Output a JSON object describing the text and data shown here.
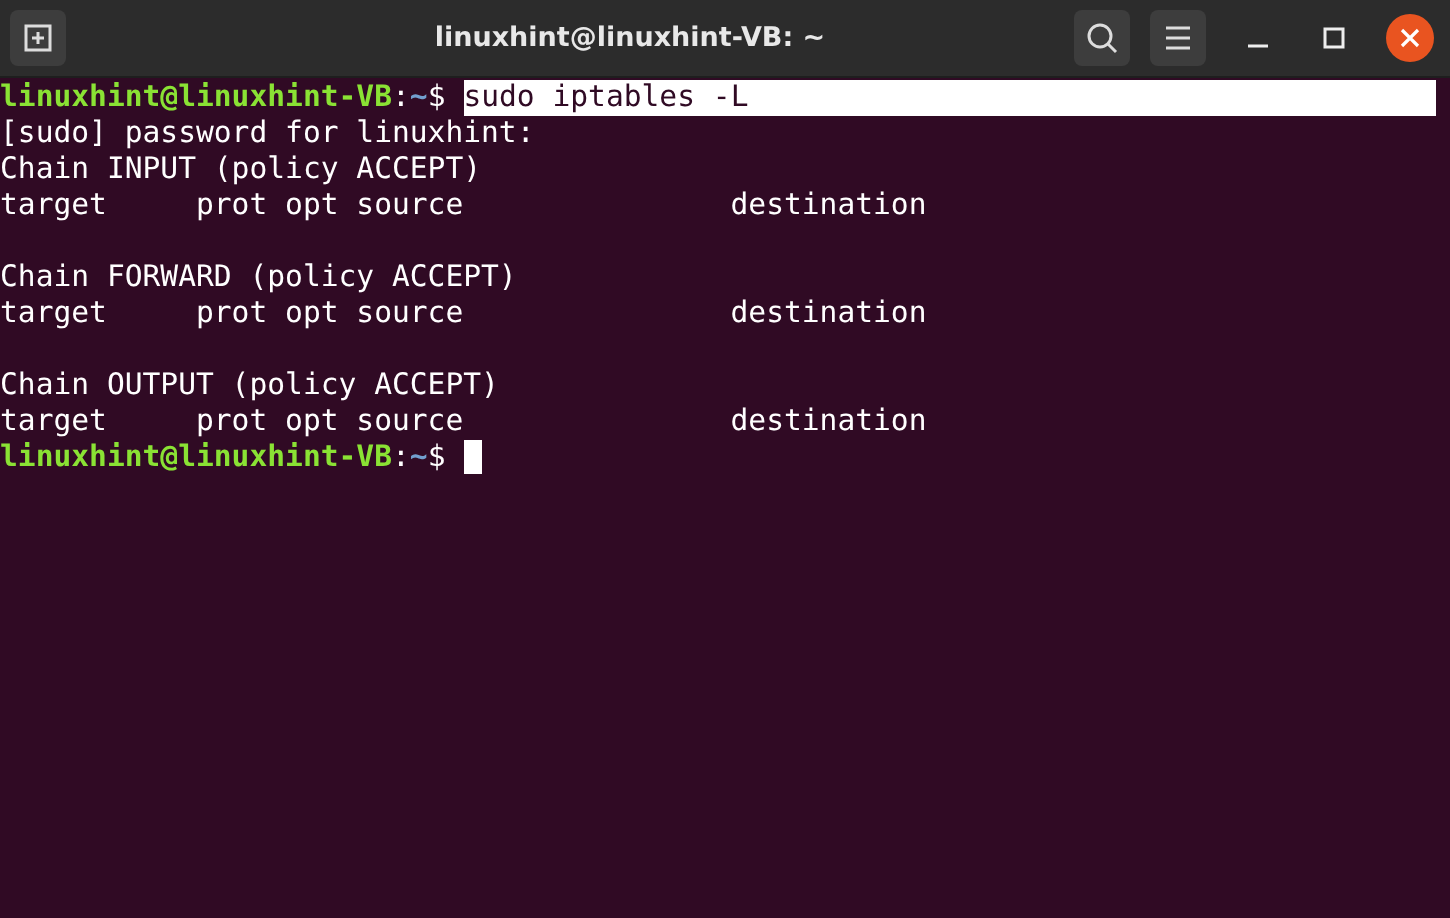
{
  "window": {
    "title": "linuxhint@linuxhint-VB: ~"
  },
  "terminal": {
    "lines": [
      {
        "kind": "prompt",
        "user_host": "linuxhint@linuxhint-VB",
        "separator": ":",
        "path": "~",
        "symbol": "$",
        "command": "sudo iptables -L",
        "selected": true
      },
      {
        "kind": "output",
        "text": "[sudo] password for linuxhint:"
      },
      {
        "kind": "output",
        "text": "Chain INPUT (policy ACCEPT)"
      },
      {
        "kind": "output",
        "text": "target     prot opt source               destination"
      },
      {
        "kind": "blank"
      },
      {
        "kind": "output",
        "text": "Chain FORWARD (policy ACCEPT)"
      },
      {
        "kind": "output",
        "text": "target     prot opt source               destination"
      },
      {
        "kind": "blank"
      },
      {
        "kind": "output",
        "text": "Chain OUTPUT (policy ACCEPT)"
      },
      {
        "kind": "output",
        "text": "target     prot opt source               destination"
      },
      {
        "kind": "prompt",
        "user_host": "linuxhint@linuxhint-VB",
        "separator": ":",
        "path": "~",
        "symbol": "$",
        "cursor": true
      }
    ]
  }
}
